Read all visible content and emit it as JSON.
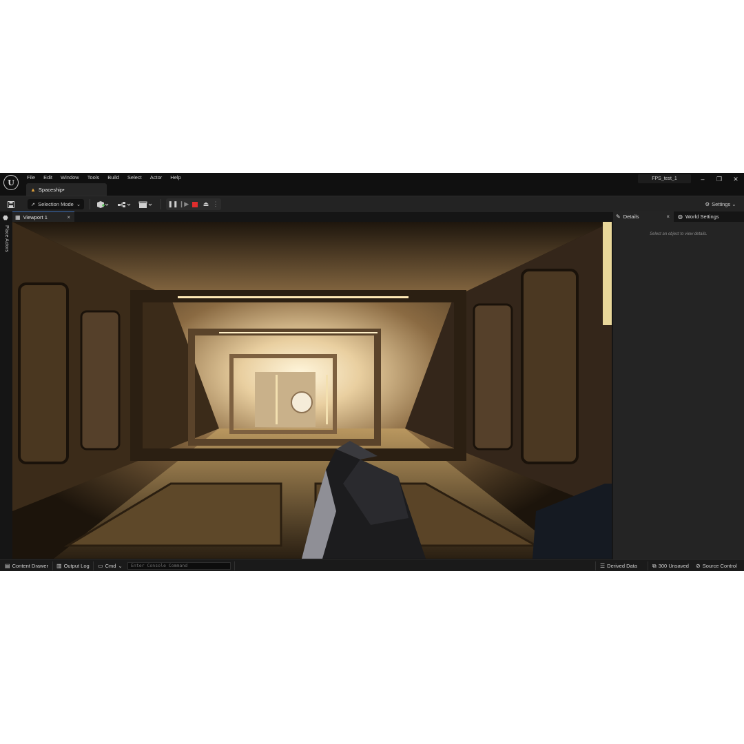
{
  "app": {
    "logo_glyph": "U"
  },
  "menu": [
    "File",
    "Edit",
    "Window",
    "Tools",
    "Build",
    "Select",
    "Actor",
    "Help"
  ],
  "document_tab": {
    "label": "Spaceship•",
    "icon": "level-icon"
  },
  "project_name": "FPS_test_1",
  "window_controls": {
    "minimize": "–",
    "restore": "❐",
    "close": "✕"
  },
  "toolbar": {
    "selection_mode": "Selection Mode",
    "settings": "Settings"
  },
  "left_strip": {
    "label": "Place Actors"
  },
  "viewport": {
    "tab_label": "Viewport 1",
    "close": "×"
  },
  "details_panel": {
    "tabs": [
      {
        "label": "Details",
        "close": "×"
      },
      {
        "label": "World Settings"
      }
    ],
    "hint": "Select an object to view details."
  },
  "status_bar": {
    "content_drawer": "Content Drawer",
    "output_log": "Output Log",
    "cmd": "Cmd",
    "console_placeholder": "Enter Console Command",
    "derived_data": "Derived Data",
    "unsaved": "300 Unsaved",
    "source_control": "Source Control"
  },
  "colors": {
    "accent": "#3d6fb6",
    "stop": "#e02d2d",
    "level_icon": "#e2a23b"
  }
}
